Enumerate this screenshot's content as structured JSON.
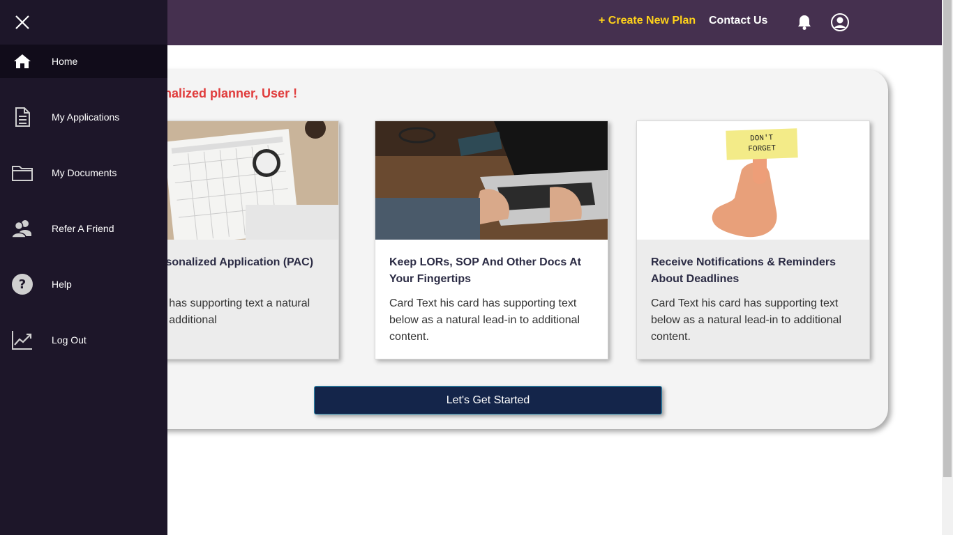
{
  "header": {
    "create_plan": "+ Create New Plan",
    "contact_us": "Contact Us",
    "accent_color": "#ffd21a",
    "background_color": "#45304f"
  },
  "main": {
    "welcome": "to your personalized planner, User !",
    "cards": [
      {
        "title": "Your Personalized Application (PAC)",
        "text": "This card has supporting text a natural lead-in to additional",
        "image": "calendar-photo"
      },
      {
        "title": "Keep LORs, SOP And Other Docs At Your Fingertips",
        "text": "Card Text his card has supporting text below as a natural lead-in to additional content.",
        "image": "laptop-photo"
      },
      {
        "title": "Receive Notifications & Reminders About Deadlines",
        "text": "Card Text his card has supporting text below as a natural lead-in to additional content.",
        "image": "dont-forget-note-photo",
        "note_text": "DON'T FORGET"
      }
    ],
    "start_button": "Let's Get Started"
  },
  "sidebar": {
    "items": [
      {
        "label": "Home",
        "icon": "home-icon",
        "active": true
      },
      {
        "label": "My Applications",
        "icon": "document-icon"
      },
      {
        "label": "My Documents",
        "icon": "folder-icon"
      },
      {
        "label": "Refer A Friend",
        "icon": "users-icon"
      },
      {
        "label": "Help",
        "icon": "help-icon"
      },
      {
        "label": "Log Out",
        "icon": "chart-line-icon"
      }
    ]
  }
}
